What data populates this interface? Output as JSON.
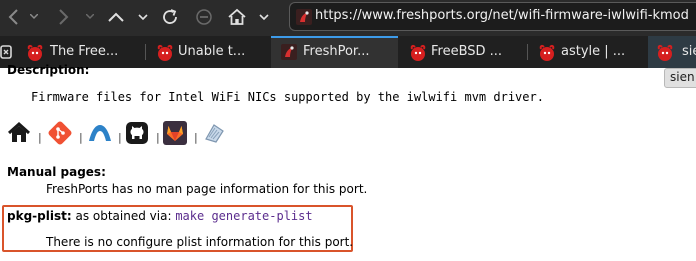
{
  "browser": {
    "url": "https://www.freshports.org/net/wifi-firmware-iwlwifi-kmod",
    "tabs": [
      {
        "title": "The Free..."
      },
      {
        "title": "Unable t..."
      },
      {
        "title": "FreshPor...",
        "active": true
      },
      {
        "title": "FreeBSD ..."
      },
      {
        "title": "astyle | ..."
      },
      {
        "title": "sie"
      }
    ],
    "tooltip": "sien"
  },
  "page": {
    "description_heading": "Description:",
    "description_text": "Firmware files for Intel WiFi NICs supported by the iwlwifi mvm driver.",
    "icon_separator": "|",
    "man_heading": "Manual pages:",
    "man_text": "FreshPorts has no man page information for this port.",
    "plist_heading": "pkg-plist:",
    "plist_via": "as obtained via:",
    "plist_command": "make generate-plist",
    "plist_text": "There is no configure plist information for this port."
  },
  "colors": {
    "highlight_border": "#d9542b",
    "active_tab_accent": "#3d9be9",
    "command_text": "#5b2d8e"
  },
  "icons": [
    "back-icon",
    "forward-icon",
    "up-icon",
    "history-dropdown-icon",
    "reload-icon",
    "stop-icon",
    "home-icon",
    "home-dropdown-icon",
    "site-favicon",
    "freebsd-tab-icon",
    "freshports-tab-icon",
    "homepage-icon",
    "git-icon",
    "freebsd-cgit-icon",
    "github-icon",
    "gitlab-icon",
    "codeberg-icon"
  ]
}
